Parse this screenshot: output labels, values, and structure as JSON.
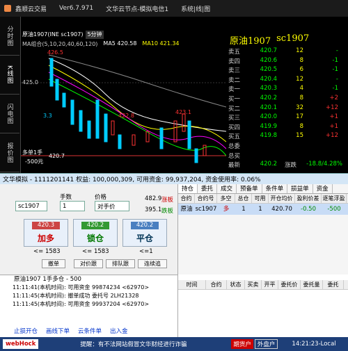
{
  "window": {
    "app": "鑫顺云交易",
    "version": "Ver6.7.971",
    "node": "文华云节点-模拟电信1",
    "menu": "系统|线|图"
  },
  "side_tabs": [
    "分时图",
    "K线图",
    "闪电图",
    "报价图"
  ],
  "chart": {
    "instrument": "原油1907(INE sc1907)",
    "period": "5分钟",
    "ma_combo": "MA组合(5,10,20,40,60,120)",
    "ma5": "MA5 420.58",
    "ma10": "MA10 421.34",
    "price_labels": [
      "426.5",
      "425.0",
      "423.3",
      "422.8",
      "423.1"
    ],
    "axis_left": [
      "425.0",
      "420.7",
      "-500元"
    ],
    "marker_note": "多单1手",
    "chart_data": {
      "type": "candlestick",
      "series": [],
      "annotations": [
        "426.5",
        "422.8",
        "423.1",
        "3.3"
      ]
    }
  },
  "quote": {
    "title": "原油1907",
    "code": "sc1907",
    "rows": [
      {
        "label": "卖五",
        "price": "420.7",
        "vol": "12",
        "chg": "-"
      },
      {
        "label": "卖四",
        "price": "420.6",
        "vol": "8",
        "chg": "-1"
      },
      {
        "label": "卖三",
        "price": "420.5",
        "vol": "6",
        "chg": "-1"
      },
      {
        "label": "卖二",
        "price": "420.4",
        "vol": "12",
        "chg": "-"
      },
      {
        "label": "卖一",
        "price": "420.3",
        "vol": "4",
        "chg": "-1"
      },
      {
        "label": "买一",
        "price": "420.2",
        "vol": "8",
        "chg": "+2"
      },
      {
        "label": "买二",
        "price": "420.1",
        "vol": "32",
        "chg": "+12"
      },
      {
        "label": "买三",
        "price": "420.0",
        "vol": "17",
        "chg": "+1"
      },
      {
        "label": "买四",
        "price": "419.9",
        "vol": "8",
        "chg": "+1"
      },
      {
        "label": "买五",
        "price": "419.8",
        "vol": "15",
        "chg": "+12"
      },
      {
        "label": "总委",
        "price": "",
        "vol": "",
        "chg": ""
      },
      {
        "label": "总买",
        "price": "",
        "vol": "",
        "chg": ""
      }
    ],
    "last_label": "最新",
    "last": "420.2",
    "change_label": "涨跌",
    "change": "-18.8/4.28%"
  },
  "status": {
    "text": "文华模拟 - 1111201141 权益: 100,000,309, 可用资金: 99,937,204, 资金使用率: 0.06%"
  },
  "order": {
    "contract": "sc1907",
    "lots_label": "手数",
    "lots": "1",
    "price_label": "价格",
    "price": "对手价",
    "right1": "482.9",
    "right1_tag": "涨板",
    "right2": "395.1",
    "right2_tag": "跌板",
    "buy": {
      "price": "420.3",
      "label": "加多",
      "sub": "<= 1583"
    },
    "lock": {
      "price": "420.2",
      "label": "锁仓",
      "sub": "<= 1583"
    },
    "close": {
      "price": "420.2",
      "label": "平仓",
      "sub": "<=1"
    },
    "buttons": [
      "撤单",
      "对价跟",
      "排队跟",
      "连续追"
    ]
  },
  "positions": {
    "tabs": [
      "持仓",
      "委托",
      "成交",
      "预备单",
      "条件单",
      "损益单",
      "资金"
    ],
    "headers": [
      "合约",
      "合约号",
      "多空",
      "总仓",
      "可用",
      "开仓均价",
      "盈利价差",
      "逐笔浮盈"
    ],
    "row": [
      "原油",
      "sc1907",
      "多",
      "1",
      "1",
      "420.70",
      "-0.50",
      "-500"
    ]
  },
  "log": {
    "header": "原油1907  1手多仓 - 500",
    "lines": [
      "11:11:41(本机时间): 可用资金 99874234 <62970>",
      "11:11:45(本机时间): 撤单成功  委托号 2LH21328",
      "11:11:45(本机时间): 可用资金 99937204 <62970>"
    ],
    "links": [
      "止损开仓",
      "画线下单",
      "云条件单",
      "出入金"
    ]
  },
  "trades": {
    "headers": [
      "时间",
      "合约",
      "状态",
      "买卖",
      "开平",
      "委托价",
      "委托量",
      "委托"
    ]
  },
  "footer": {
    "brand": "webHock",
    "notice": "提醒：有不法网站假冒文华财经进行诈骗",
    "status1": "期货户",
    "status2": "外盘户",
    "time": "14:21:23-Local"
  }
}
